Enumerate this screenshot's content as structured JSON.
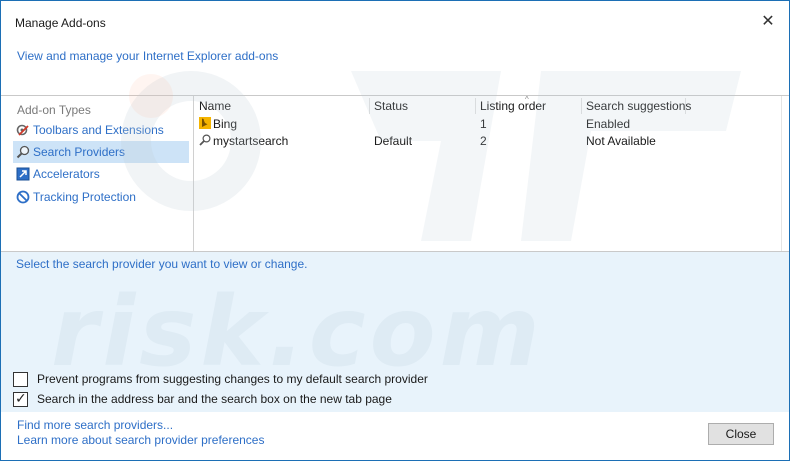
{
  "window": {
    "title": "Manage Add-ons"
  },
  "header": {
    "link_text": "View and manage your Internet Explorer add-ons"
  },
  "sidebar": {
    "heading": "Add-on Types",
    "items": [
      {
        "label": "Toolbars and Extensions",
        "icon": "toolbar-gear-icon"
      },
      {
        "label": "Search Providers",
        "icon": "magnifier-icon",
        "selected": true
      },
      {
        "label": "Accelerators",
        "icon": "accelerator-icon"
      },
      {
        "label": "Tracking Protection",
        "icon": "no-entry-icon"
      }
    ]
  },
  "table": {
    "columns": [
      "Name",
      "Status",
      "Listing order",
      "Search suggestions"
    ],
    "rows": [
      {
        "icon": "bing-icon",
        "name": "Bing",
        "status": "",
        "order": "1",
        "suggestions": "Enabled"
      },
      {
        "icon": "magnifier-icon",
        "name": "mystartsearch",
        "status": "Default",
        "order": "2",
        "suggestions": "Not Available"
      }
    ]
  },
  "details": {
    "prompt": "Select the search provider you want to view or change.",
    "checkboxes": [
      {
        "label": "Prevent programs from suggesting changes to my default search provider",
        "checked": false
      },
      {
        "label": "Search in the address bar and the search box on the new tab page",
        "checked": true
      }
    ]
  },
  "footer": {
    "links": [
      "Find more search providers...",
      "Learn more about search provider preferences"
    ],
    "close_label": "Close"
  },
  "watermark": {
    "text": "risk.com"
  },
  "colors": {
    "accent": "#2e6fc7",
    "selection": "#cde3f7",
    "details_bg": "#e8f3fb",
    "border": "#1c6fb5"
  }
}
